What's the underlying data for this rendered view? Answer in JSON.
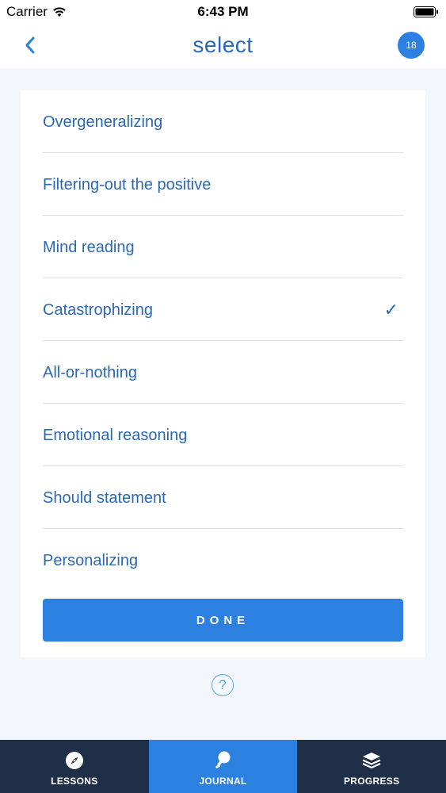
{
  "status_bar": {
    "carrier": "Carrier",
    "time": "6:43 PM"
  },
  "nav": {
    "title": "select",
    "badge": "18"
  },
  "options": [
    {
      "label": "Overgeneralizing",
      "selected": false
    },
    {
      "label": "Filtering-out the positive",
      "selected": false
    },
    {
      "label": "Mind reading",
      "selected": false
    },
    {
      "label": "Catastrophizing",
      "selected": true
    },
    {
      "label": "All-or-nothing",
      "selected": false
    },
    {
      "label": "Emotional reasoning",
      "selected": false
    },
    {
      "label": "Should statement",
      "selected": false
    },
    {
      "label": "Personalizing",
      "selected": false
    }
  ],
  "check_glyph": "✓",
  "done_label": "DONE",
  "help_glyph": "?",
  "tabs": [
    {
      "label": "LESSONS",
      "icon": "compass-icon",
      "active": false
    },
    {
      "label": "JOURNAL",
      "icon": "lightbulb-icon",
      "active": true
    },
    {
      "label": "PROGRESS",
      "icon": "layers-icon",
      "active": false
    }
  ],
  "colors": {
    "accent": "#2c80e0",
    "text_blue": "#2a69b3",
    "tab_bar": "#1f2f48",
    "background": "#f3f6fc"
  }
}
